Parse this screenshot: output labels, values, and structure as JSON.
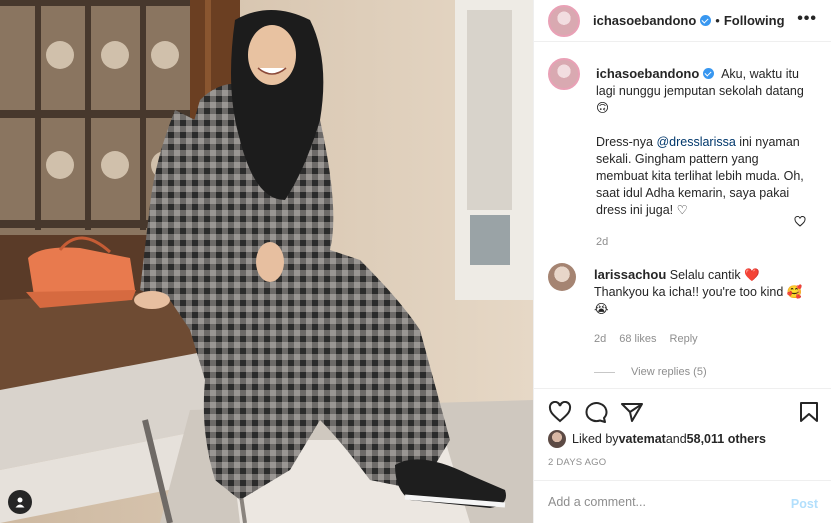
{
  "post": {
    "author": "ichasoebandono",
    "follow_label": "Following",
    "more_label": "•••"
  },
  "caption": {
    "author": "ichasoebandono",
    "line1": "Aku, waktu itu lagi nunggu jemputan sekolah datang 🙃",
    "line2_prefix": "Dress-nya ",
    "mention": "@dresslarissa",
    "line2_rest": " ini nyaman sekali. Gingham pattern yang membuat kita terlihat lebih muda. Oh, saat idul Adha kemarin, saya pakai dress ini juga! ♡",
    "time": "2d"
  },
  "comment": {
    "author": "larissachou",
    "text": "Selalu cantik ❤️ Thankyou ka icha!! you're too kind 🥰😭",
    "time": "2d",
    "likes": "68 likes",
    "reply_label": "Reply",
    "view_replies": "View replies (5)"
  },
  "likes": {
    "prefix": "Liked by ",
    "user": "vatemat",
    "middle": " and ",
    "count": "58,011 others"
  },
  "date_label": "2 DAYS AGO",
  "add_comment": {
    "placeholder": "Add a comment...",
    "post_label": "Post"
  },
  "colors": {
    "link": "#00376b",
    "verified": "#3897f0",
    "post_btn": "#b2dffc",
    "heart": "#ed4956"
  }
}
